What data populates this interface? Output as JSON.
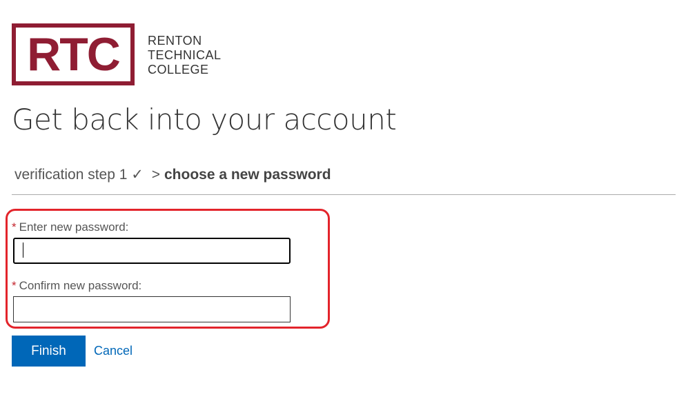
{
  "logo": {
    "mark": "RTC",
    "line1": "RENTON",
    "line2": "TECHNICAL",
    "line3": "COLLEGE",
    "color": "#8f1d33"
  },
  "page_title": "Get back into your account",
  "breadcrumb": {
    "step1": "verification step 1",
    "check": "✓",
    "separator": ">",
    "current": "choose a new password"
  },
  "form": {
    "required_marker": "*",
    "new_password_label": "Enter new password:",
    "new_password_value": "",
    "confirm_password_label": "Confirm new password:",
    "confirm_password_value": ""
  },
  "actions": {
    "finish_label": "Finish",
    "cancel_label": "Cancel"
  },
  "colors": {
    "primary": "#0067b8",
    "highlight": "#e3242b",
    "required": "#c4262e"
  }
}
